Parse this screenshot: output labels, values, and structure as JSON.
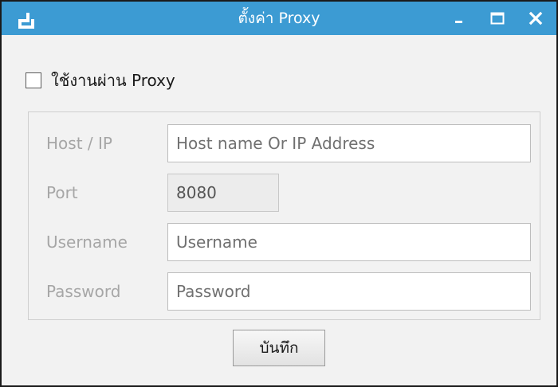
{
  "window": {
    "title": "ตั้งค่า Proxy",
    "controls": {
      "minimize": "_",
      "maximize": "☐",
      "close": "✕"
    }
  },
  "proxy_toggle": {
    "label": "ใช้งานผ่าน Proxy",
    "checked": false
  },
  "form": {
    "host": {
      "label": "Host / IP",
      "value": "",
      "placeholder": "Host name Or IP Address"
    },
    "port": {
      "label": "Port",
      "value": "8080"
    },
    "username": {
      "label": "Username",
      "value": "",
      "placeholder": "Username"
    },
    "password": {
      "label": "Password",
      "value": "",
      "placeholder": "Password"
    }
  },
  "actions": {
    "save_label": "บันทึก"
  },
  "colors": {
    "titlebar": "#3c9bd3",
    "window_bg": "#f2f2f2",
    "disabled_label": "#a6a6a6"
  }
}
